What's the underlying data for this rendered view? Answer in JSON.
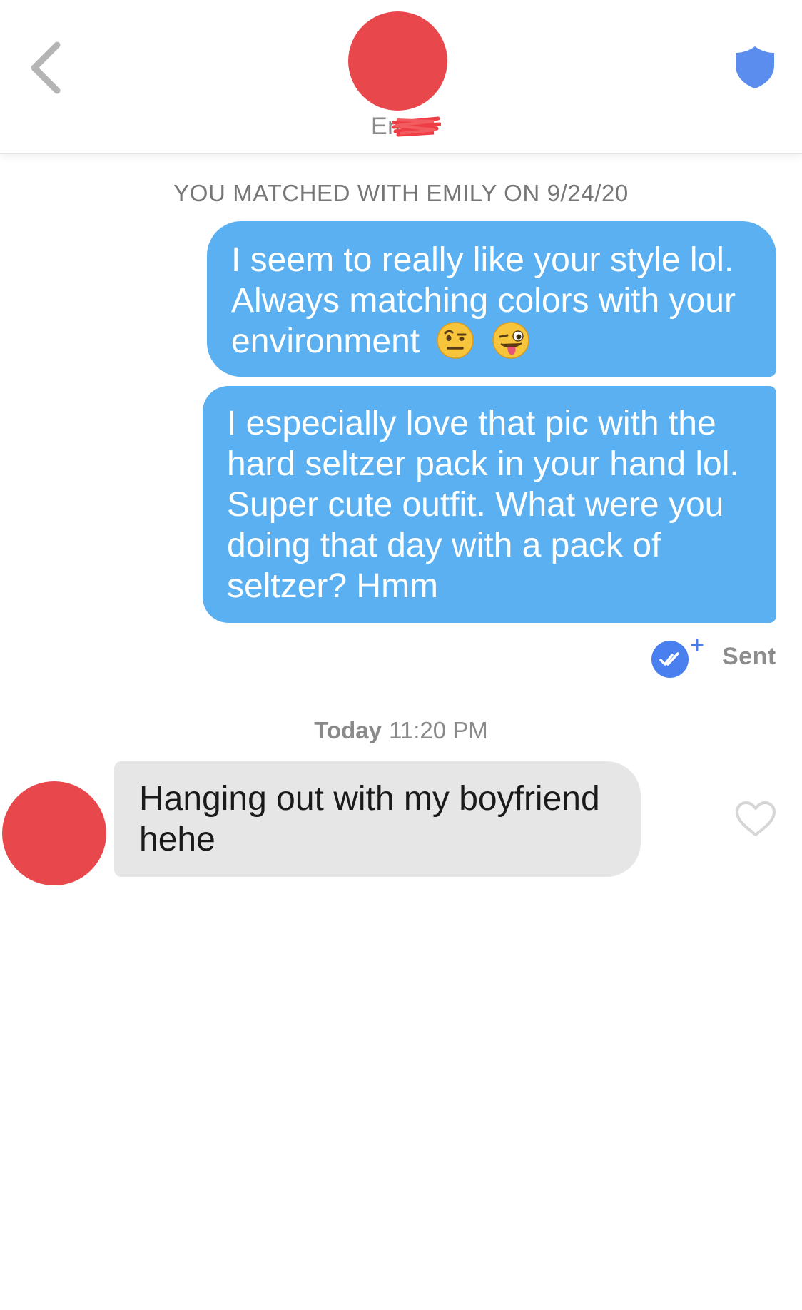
{
  "header": {
    "name": "Em",
    "back_icon": "chevron-left-icon",
    "shield_icon": "shield-icon",
    "accent_color": "#5b8def",
    "avatar_color": "#e8474c"
  },
  "match_text": "YOU MATCHED WITH EMILY ON 9/24/20",
  "messages": [
    {
      "direction": "outgoing",
      "lines": [
        "I seem to really like your style lol.",
        "Always matching colors with your",
        "environment"
      ],
      "emojis": [
        "face-with-raised-eyebrow-emoji",
        "winking-face-with-tongue-emoji"
      ]
    },
    {
      "direction": "outgoing",
      "lines": [
        "I especially love that pic with the",
        "hard seltzer pack in your hand lol.",
        "Super cute outfit. What were you",
        "doing that day with a pack of",
        "seltzer? Hmm"
      ]
    },
    {
      "direction": "incoming",
      "lines": [
        "Hanging out with my boyfriend",
        "hehe"
      ]
    }
  ],
  "status": {
    "sent_label": "Sent",
    "check_icon": "double-check-icon"
  },
  "timestamp": {
    "day": "Today",
    "time": "11:20 PM"
  },
  "colors": {
    "outgoing_bubble": "#5bb0f1",
    "incoming_bubble": "#e6e6e6"
  }
}
